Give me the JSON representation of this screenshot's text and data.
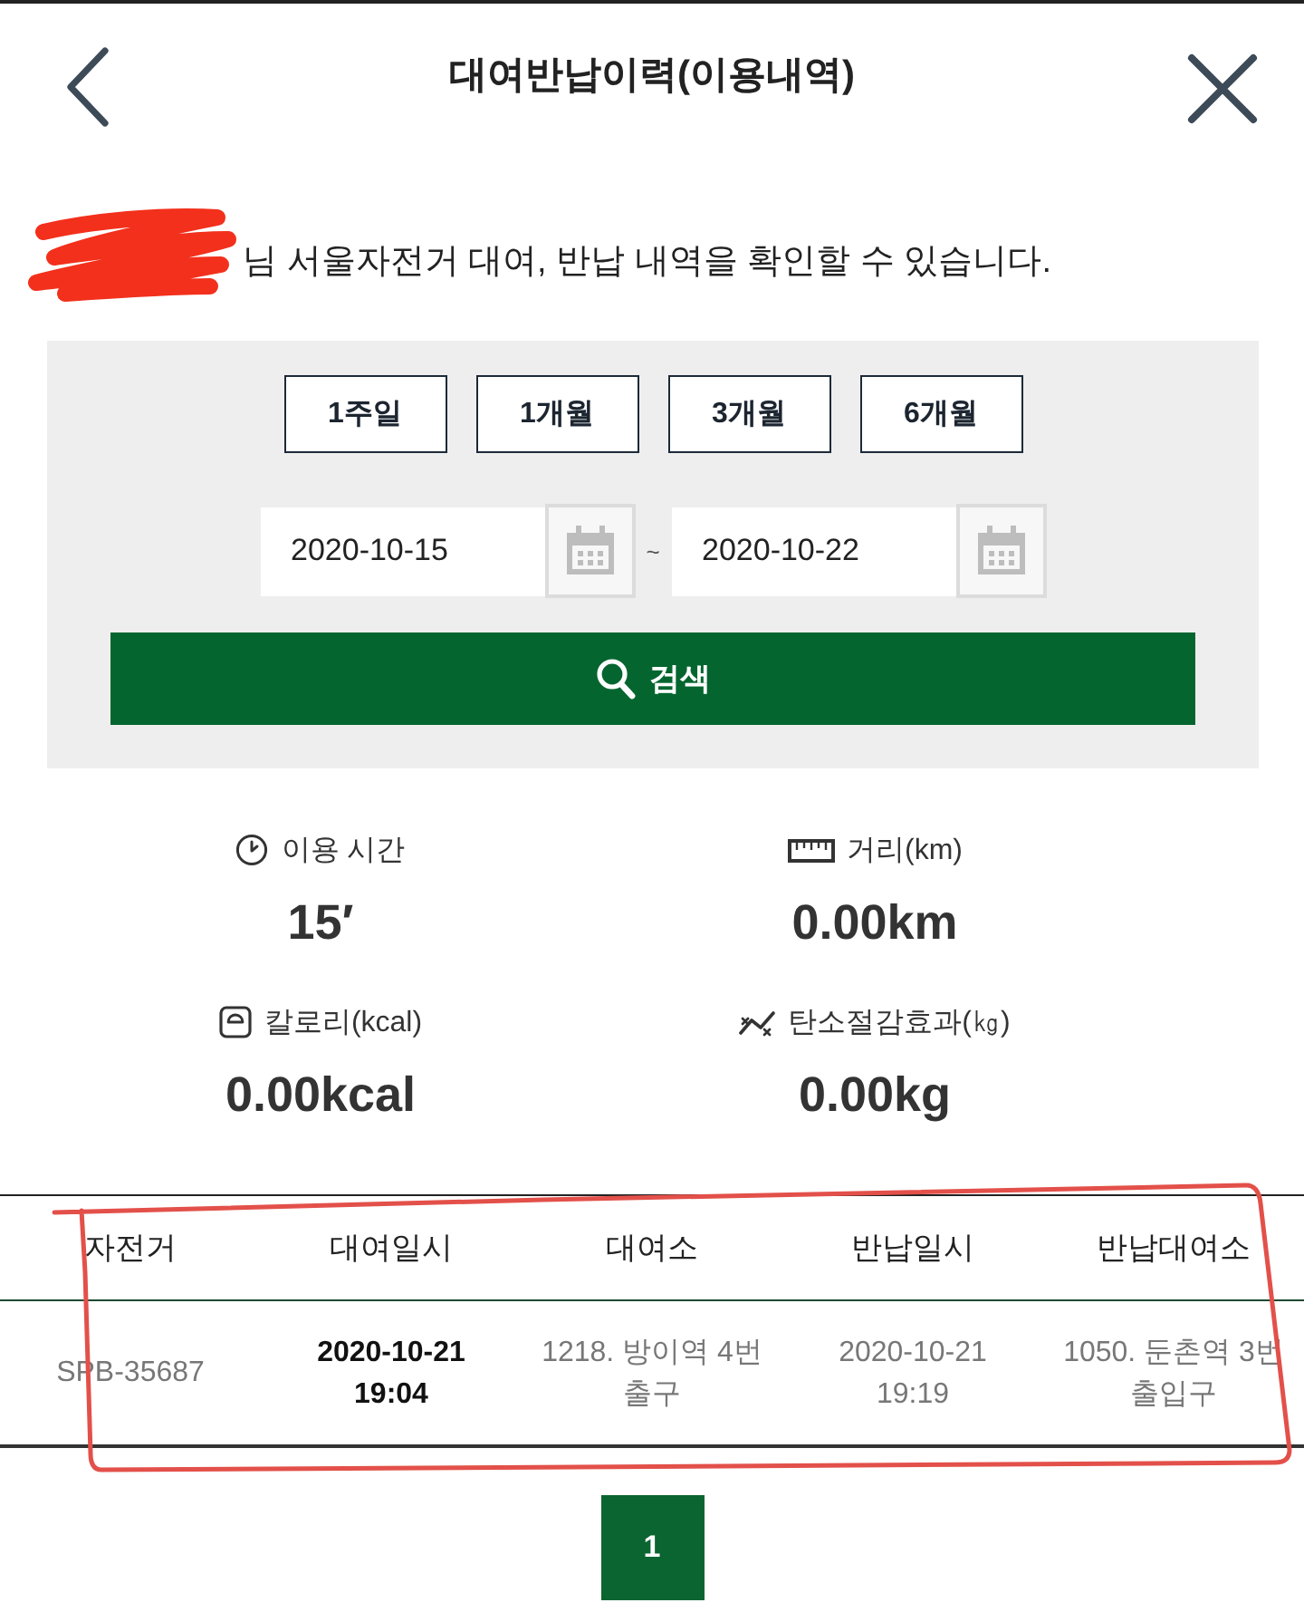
{
  "header": {
    "title": "대여반납이력(이용내역)"
  },
  "intro": {
    "redacted": true,
    "text": "님 서울자전거 대여, 반납 내역을 확인할 수 있습니다."
  },
  "search": {
    "periods": [
      {
        "label": "1주일"
      },
      {
        "label": "1개월"
      },
      {
        "label": "3개월"
      },
      {
        "label": "6개월"
      }
    ],
    "start_date": "2020-10-15",
    "separator": "~",
    "end_date": "2020-10-22",
    "button": "검색"
  },
  "stats": [
    {
      "kind": "time",
      "label": "이용 시간",
      "value": "15′"
    },
    {
      "kind": "distance",
      "label": "거리(km)",
      "value": "0.00km"
    },
    {
      "kind": "calories",
      "label": "칼로리(kcal)",
      "value": "0.00kcal"
    },
    {
      "kind": "carbon",
      "label": "탄소절감효과(㎏)",
      "value": "0.00kg"
    }
  ],
  "table": {
    "hand_drawn_outline": true,
    "columns": [
      "자전거",
      "대여일시",
      "대여소",
      "반납일시",
      "반납대여소"
    ],
    "rows": [
      {
        "cells": [
          "SPB-35687",
          "2020-10-21\n19:04",
          "1218. 방이역 4번\n출구",
          "2020-10-21\n19:19",
          "1050. 둔촌역 3번\n출입구"
        ]
      }
    ]
  },
  "pagination": {
    "pages": [
      {
        "label": "1",
        "selected": true
      }
    ]
  }
}
